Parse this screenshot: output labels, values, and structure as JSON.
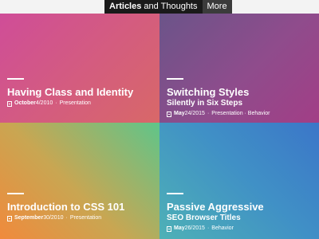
{
  "nav": {
    "articles_bold": "Articles",
    "articles_rest": " and Thoughts",
    "more": "More"
  },
  "colors": {
    "nav_active_bg": "#1a1a1a",
    "nav_more_bg": "#3b3b3b",
    "text": "#ffffff"
  },
  "tiles": [
    {
      "title": "Having Class and Identity",
      "subtitle": "",
      "meta": {
        "icon": "document-icon",
        "month": "October",
        "date": " 4/2010",
        "separator": "·",
        "tags": "Presentation"
      },
      "gradient": [
        "#cf4d98",
        "#d86868"
      ]
    },
    {
      "title": "Switching Styles",
      "subtitle": "Silently in Six Steps",
      "meta": {
        "icon": "document-icon",
        "month": "May",
        "date": " 24/2015",
        "separator": "·",
        "tags": "Presentation · Behavior"
      },
      "gradient": [
        "#6b5489",
        "#a23e86"
      ]
    },
    {
      "title": "Introduction to CSS 101",
      "subtitle": "",
      "meta": {
        "icon": "document-icon",
        "month": "September",
        "date": " 30/2010",
        "separator": "·",
        "tags": "Presentation"
      },
      "gradient": [
        "#f08a3c",
        "#5fc58a"
      ]
    },
    {
      "title": "Passive Aggressive",
      "subtitle": "SEO Browser Titles",
      "meta": {
        "icon": "document-icon",
        "month": "May",
        "date": " 26/2015",
        "separator": "·",
        "tags": "Behavior"
      },
      "gradient": [
        "#4eb1b6",
        "#3b76c8"
      ]
    }
  ]
}
